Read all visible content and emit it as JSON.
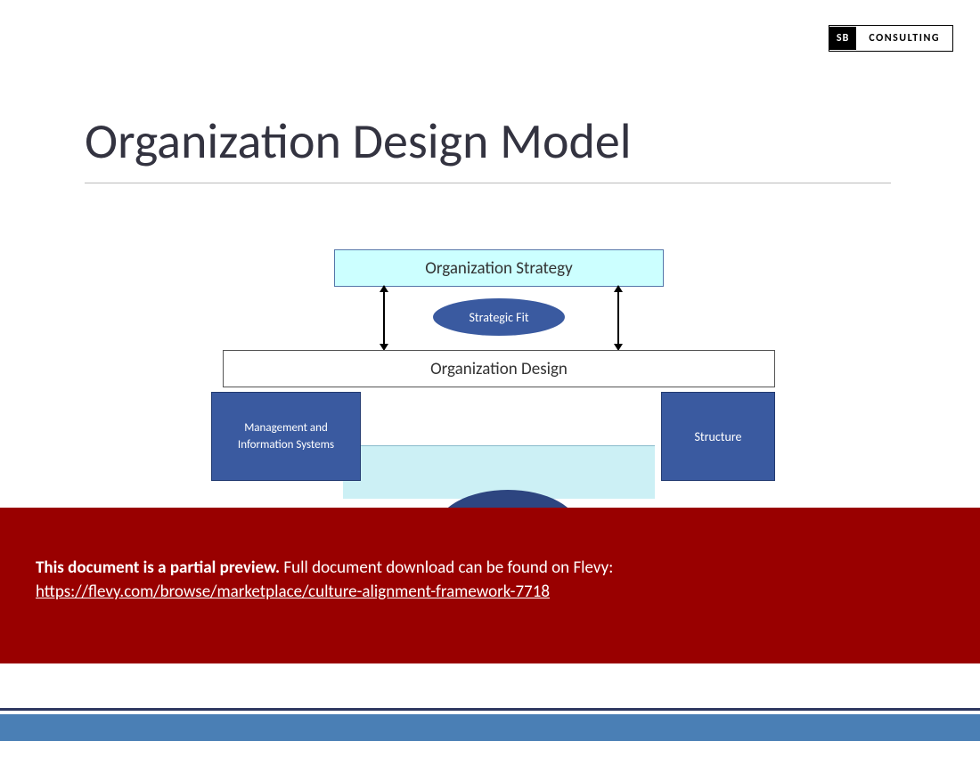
{
  "logo": {
    "sb": "SB",
    "consulting": "CONSULTING"
  },
  "title": "Organization Design Model",
  "diagram": {
    "org_strategy": "Organization Strategy",
    "strategic_fit": "Strategic Fit",
    "org_design": "Organization Design",
    "mgmt_info": "Management and Information Systems",
    "structure": "Structure"
  },
  "banner": {
    "lead": "This document is a partial preview.",
    "rest": "  Full document download can be found on Flevy:",
    "link": "https://flevy.com/browse/marketplace/culture-alignment-framework-7718"
  }
}
